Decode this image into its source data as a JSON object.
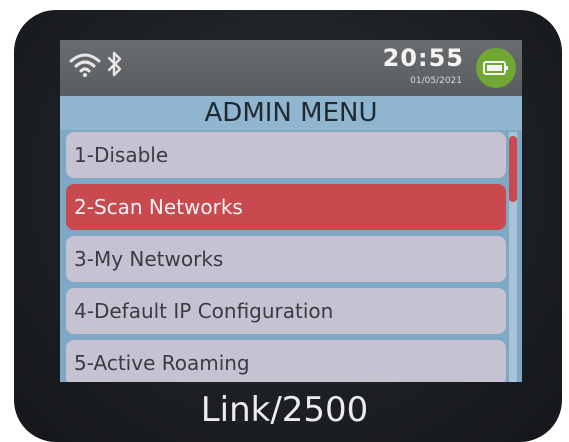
{
  "status_bar": {
    "time": "20:55",
    "date": "01/05/2021",
    "icons": [
      "wifi-icon",
      "bluetooth-icon",
      "battery-icon"
    ],
    "battery_color": "#6fa832"
  },
  "menu": {
    "title": "ADMIN MENU",
    "items": [
      {
        "label": "1-Disable",
        "selected": false
      },
      {
        "label": "2-Scan Networks",
        "selected": true
      },
      {
        "label": "3-My Networks",
        "selected": false
      },
      {
        "label": "4-Default IP Configuration",
        "selected": false
      },
      {
        "label": "5-Active Roaming",
        "selected": false
      }
    ],
    "selected_color": "#c84a4f",
    "item_color": "#c7c2d2"
  },
  "device": {
    "model": "Link/2500"
  }
}
